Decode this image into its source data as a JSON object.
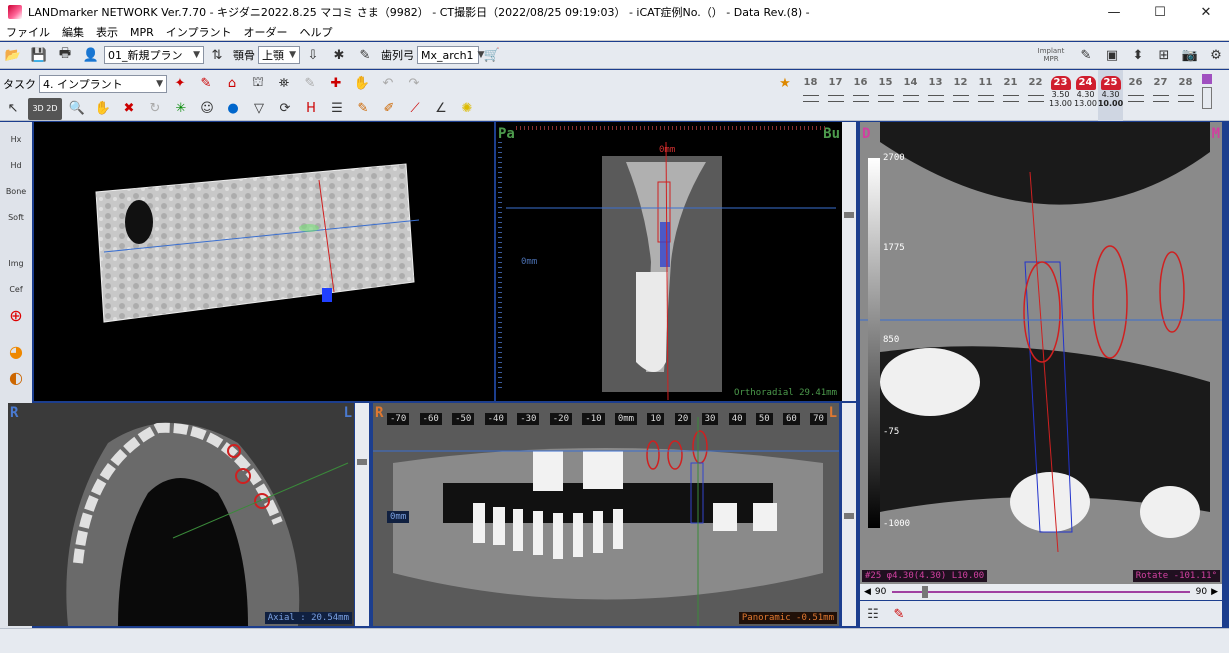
{
  "window": {
    "title": "LANDmarker NETWORK Ver.7.70 - キジダニ2022.8.25 マコミ さま（9982） - CT撮影日（2022/08/25 09:19:03） - iCAT症例No.（） - Data Rev.(8) -",
    "minimize": "—",
    "maximize": "☐",
    "close": "✕"
  },
  "menu": [
    "ファイル",
    "編集",
    "表示",
    "MPR",
    "インプラント",
    "オーダー",
    "ヘルプ"
  ],
  "toolbar1": {
    "plan_select": "01_新規プラン",
    "jaw_label": "顎骨",
    "jaw_select": "上顎",
    "arch_label": "歯列弓",
    "arch_select": "Mx_arch1",
    "implant_mpr_label": "Implant MPR"
  },
  "toolbar2": {
    "task_label": "タスク",
    "task_select": "4. インプラント"
  },
  "toolbar3": {
    "mode_3d": "3D",
    "mode_2d": "2D"
  },
  "teeth": [
    {
      "num": "18",
      "l1": "",
      "l2": "",
      "active": false
    },
    {
      "num": "17",
      "l1": "",
      "l2": "",
      "active": false
    },
    {
      "num": "16",
      "l1": "",
      "l2": "",
      "active": false
    },
    {
      "num": "15",
      "l1": "",
      "l2": "",
      "active": false
    },
    {
      "num": "14",
      "l1": "",
      "l2": "",
      "active": false
    },
    {
      "num": "13",
      "l1": "",
      "l2": "",
      "active": false
    },
    {
      "num": "12",
      "l1": "",
      "l2": "",
      "active": false
    },
    {
      "num": "11",
      "l1": "",
      "l2": "",
      "active": false
    },
    {
      "num": "21",
      "l1": "",
      "l2": "",
      "active": false
    },
    {
      "num": "22",
      "l1": "",
      "l2": "",
      "active": false
    },
    {
      "num": "23",
      "l1": "3.50",
      "l2": "13.00",
      "active": true
    },
    {
      "num": "24",
      "l1": "4.30",
      "l2": "13.00",
      "active": true
    },
    {
      "num": "25",
      "l1": "4.30",
      "l2": "10.00",
      "active": true,
      "selected": true
    },
    {
      "num": "26",
      "l1": "",
      "l2": "",
      "active": false
    },
    {
      "num": "27",
      "l1": "",
      "l2": "",
      "active": false
    },
    {
      "num": "28",
      "l1": "",
      "l2": "",
      "active": false
    }
  ],
  "leftbar": [
    "Hx",
    "Hd",
    "Bone",
    "Soft",
    "Img",
    "Cef",
    "",
    "",
    ""
  ],
  "views": {
    "ortho": {
      "left": "Pa",
      "right": "Bu",
      "center_mm": "0mm",
      "side_mm": "0mm",
      "readout": "Orthoradial 29.41mm"
    },
    "axial": {
      "left": "R",
      "right": "L",
      "readout": "Axial : 20.54mm"
    },
    "panoramic": {
      "left": "R",
      "right": "L",
      "side_mm": "0mm",
      "readout": "Panoramic -0.51mm",
      "ruler": [
        "-70",
        "-60",
        "-50",
        "-40",
        "-30",
        "-20",
        "-10",
        "0mm",
        "10",
        "20",
        "30",
        "40",
        "50",
        "60",
        "70"
      ]
    },
    "implant": {
      "left": "D",
      "right": "M",
      "scale_top": "2700",
      "scale_mid1": "1775",
      "scale_mid2": "850",
      "scale_low": "-75",
      "scale_bottom": "-1000",
      "info": "#25 φ4.30(4.30) L10.00",
      "rotate": "Rotate -101.11°",
      "rot_min": "90",
      "rot_max": "90"
    }
  }
}
